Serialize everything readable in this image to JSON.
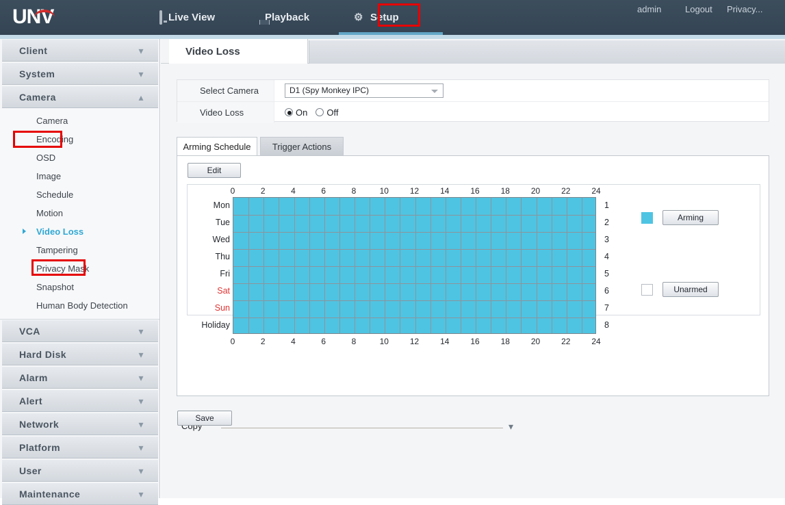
{
  "header": {
    "logo_text": "UNV",
    "nav": [
      {
        "label": "Live View",
        "icon": "monitor-icon",
        "active": false
      },
      {
        "label": "Playback",
        "icon": "film-strip-icon",
        "active": false
      },
      {
        "label": "Setup",
        "icon": "gear-icon",
        "active": true
      }
    ],
    "account": {
      "user": "admin",
      "logout_label": "Logout",
      "privacy_label": "Privacy..."
    },
    "highlight_color": "#e60000",
    "active_tab_color": "#63a7c7"
  },
  "sidebar": {
    "groups": [
      {
        "label": "Client",
        "expanded": false
      },
      {
        "label": "System",
        "expanded": false
      },
      {
        "label": "Camera",
        "expanded": true,
        "highlighted": true,
        "items": [
          {
            "label": "Camera",
            "active": false
          },
          {
            "label": "Encoding",
            "active": false
          },
          {
            "label": "OSD",
            "active": false
          },
          {
            "label": "Image",
            "active": false
          },
          {
            "label": "Schedule",
            "active": false
          },
          {
            "label": "Motion",
            "active": false
          },
          {
            "label": "Video Loss",
            "active": true,
            "highlighted": true
          },
          {
            "label": "Tampering",
            "active": false
          },
          {
            "label": "Privacy Mask",
            "active": false
          },
          {
            "label": "Snapshot",
            "active": false
          },
          {
            "label": "Human Body Detection",
            "active": false
          }
        ]
      },
      {
        "label": "VCA",
        "expanded": false
      },
      {
        "label": "Hard Disk",
        "expanded": false
      },
      {
        "label": "Alarm",
        "expanded": false
      },
      {
        "label": "Alert",
        "expanded": false
      },
      {
        "label": "Network",
        "expanded": false
      },
      {
        "label": "Platform",
        "expanded": false
      },
      {
        "label": "User",
        "expanded": false
      },
      {
        "label": "Maintenance",
        "expanded": false
      }
    ],
    "active_color": "#2fa8d4"
  },
  "main": {
    "page_tab": "Video Loss",
    "form": {
      "select_camera_label": "Select Camera",
      "select_camera_value": "D1 (Spy Monkey IPC)",
      "video_loss_label": "Video Loss",
      "radio_on": "On",
      "radio_off": "Off",
      "radio_selected": "On"
    },
    "inner_tabs": [
      {
        "label": "Arming Schedule",
        "selected": true
      },
      {
        "label": "Trigger Actions",
        "selected": false
      }
    ],
    "edit_label": "Edit",
    "copy_label": "Copy",
    "save_label": "Save",
    "legend": [
      {
        "swatch": "filled",
        "label": "Arming",
        "color": "#4ec4e2"
      },
      {
        "swatch": "empty",
        "label": "Unarmed",
        "color": "#ffffff"
      }
    ]
  },
  "chart_data": {
    "type": "heatmap",
    "title": "Arming Schedule",
    "xlabel": "",
    "ylabel": "",
    "x_ticks_top": [
      "0",
      "2",
      "4",
      "6",
      "8",
      "10",
      "12",
      "14",
      "16",
      "18",
      "20",
      "22",
      "24"
    ],
    "x_ticks_bottom": [
      "0",
      "2",
      "4",
      "6",
      "8",
      "10",
      "12",
      "14",
      "16",
      "18",
      "20",
      "22",
      "24"
    ],
    "categories": [
      "Mon",
      "Tue",
      "Wed",
      "Thu",
      "Fri",
      "Sat",
      "Sun",
      "Holiday"
    ],
    "weekend_rows": [
      "Sat",
      "Sun"
    ],
    "row_numbers": [
      "1",
      "2",
      "3",
      "4",
      "5",
      "6",
      "7",
      "8"
    ],
    "xlim": [
      0,
      24
    ],
    "grid": true,
    "legend_position": "right",
    "values": [
      [
        1,
        1,
        1,
        1,
        1,
        1,
        1,
        1,
        1,
        1,
        1,
        1,
        1,
        1,
        1,
        1,
        1,
        1,
        1,
        1,
        1,
        1,
        1,
        1
      ],
      [
        1,
        1,
        1,
        1,
        1,
        1,
        1,
        1,
        1,
        1,
        1,
        1,
        1,
        1,
        1,
        1,
        1,
        1,
        1,
        1,
        1,
        1,
        1,
        1
      ],
      [
        1,
        1,
        1,
        1,
        1,
        1,
        1,
        1,
        1,
        1,
        1,
        1,
        1,
        1,
        1,
        1,
        1,
        1,
        1,
        1,
        1,
        1,
        1,
        1
      ],
      [
        1,
        1,
        1,
        1,
        1,
        1,
        1,
        1,
        1,
        1,
        1,
        1,
        1,
        1,
        1,
        1,
        1,
        1,
        1,
        1,
        1,
        1,
        1,
        1
      ],
      [
        1,
        1,
        1,
        1,
        1,
        1,
        1,
        1,
        1,
        1,
        1,
        1,
        1,
        1,
        1,
        1,
        1,
        1,
        1,
        1,
        1,
        1,
        1,
        1
      ],
      [
        1,
        1,
        1,
        1,
        1,
        1,
        1,
        1,
        1,
        1,
        1,
        1,
        1,
        1,
        1,
        1,
        1,
        1,
        1,
        1,
        1,
        1,
        1,
        1
      ],
      [
        1,
        1,
        1,
        1,
        1,
        1,
        1,
        1,
        1,
        1,
        1,
        1,
        1,
        1,
        1,
        1,
        1,
        1,
        1,
        1,
        1,
        1,
        1,
        1
      ],
      [
        1,
        1,
        1,
        1,
        1,
        1,
        1,
        1,
        1,
        1,
        1,
        1,
        1,
        1,
        1,
        1,
        1,
        1,
        1,
        1,
        1,
        1,
        1,
        1
      ]
    ]
  }
}
